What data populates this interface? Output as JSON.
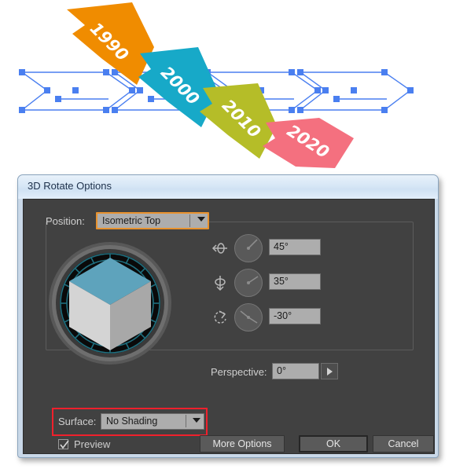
{
  "artboard": {
    "arrows": [
      {
        "label": "1990",
        "color": "#f08c00"
      },
      {
        "label": "2000",
        "color": "#17a9c8"
      },
      {
        "label": "2010",
        "color": "#b5bd28"
      },
      {
        "label": "2020",
        "color": "#f4707f"
      }
    ],
    "selection_color": "#4a7ff0",
    "chevron_count": 4
  },
  "dialog": {
    "title": "3D Rotate Options",
    "position": {
      "label": "Position:",
      "value": "Isometric Top",
      "focus_color": "#e8922e"
    },
    "rotations": [
      {
        "icon": "rotate-x-axis-icon",
        "value": "45°",
        "angle": 45
      },
      {
        "icon": "rotate-y-axis-icon",
        "value": "35°",
        "angle": 35
      },
      {
        "icon": "rotate-z-axis-icon",
        "value": "-30°",
        "angle": -30
      }
    ],
    "perspective": {
      "label": "Perspective:",
      "value": "0°"
    },
    "surface": {
      "label": "Surface:",
      "value": "No Shading",
      "highlight_color": "#f0202c"
    },
    "preview": {
      "label": "Preview",
      "checked": true
    },
    "buttons": {
      "more_options": "More Options",
      "ok": "OK",
      "cancel": "Cancel"
    },
    "cube": {
      "top_color": "#5ea3bc",
      "left_color": "#d4d4d4",
      "right_color": "#a8a8a8",
      "track_color": "#1f6e7e"
    }
  }
}
